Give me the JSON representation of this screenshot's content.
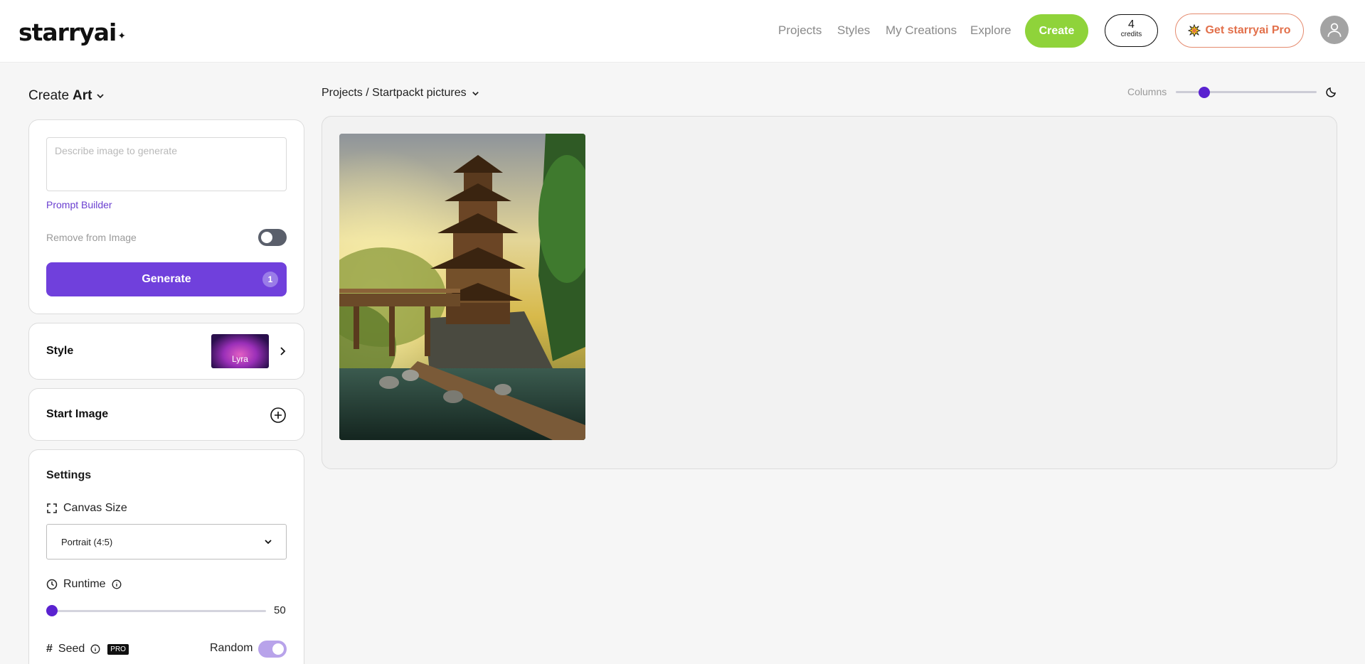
{
  "header": {
    "logo": "starryai",
    "logo_mark": "✦",
    "nav": [
      "Projects",
      "Styles",
      "My Creations",
      "Explore"
    ],
    "create_label": "Create",
    "credits_count": "4",
    "credits_label": "credits",
    "pro_label": "Get starryai Pro",
    "pro_icon": "sparkle-badge-icon",
    "avatar_icon": "user-icon"
  },
  "sidebar": {
    "create_prefix": "Create",
    "create_mode": "Art",
    "prompt_placeholder": "Describe image to generate",
    "prompt_builder": "Prompt Builder",
    "remove_from_image": "Remove from Image",
    "remove_enabled": false,
    "generate_label": "Generate",
    "generate_count": "1",
    "style_label": "Style",
    "style_name": "Lyra",
    "start_image_label": "Start Image",
    "settings_title": "Settings",
    "canvas_size_label": "Canvas Size",
    "canvas_size_value": "Portrait (4:5)",
    "runtime_label": "Runtime",
    "runtime_value": "50",
    "runtime_fraction": 0.0,
    "seed_label": "Seed",
    "pro_badge": "PRO",
    "random_label": "Random",
    "random_enabled": true
  },
  "main": {
    "breadcrumb": "Projects / Startpackt pictures",
    "columns_label": "Columns",
    "columns_fraction": 0.2,
    "image_subject": "pagoda-bridge-artwork"
  },
  "colors": {
    "accent_purple": "#7040dc",
    "create_green": "#8fd33a",
    "pro_orange": "#e2704b"
  }
}
